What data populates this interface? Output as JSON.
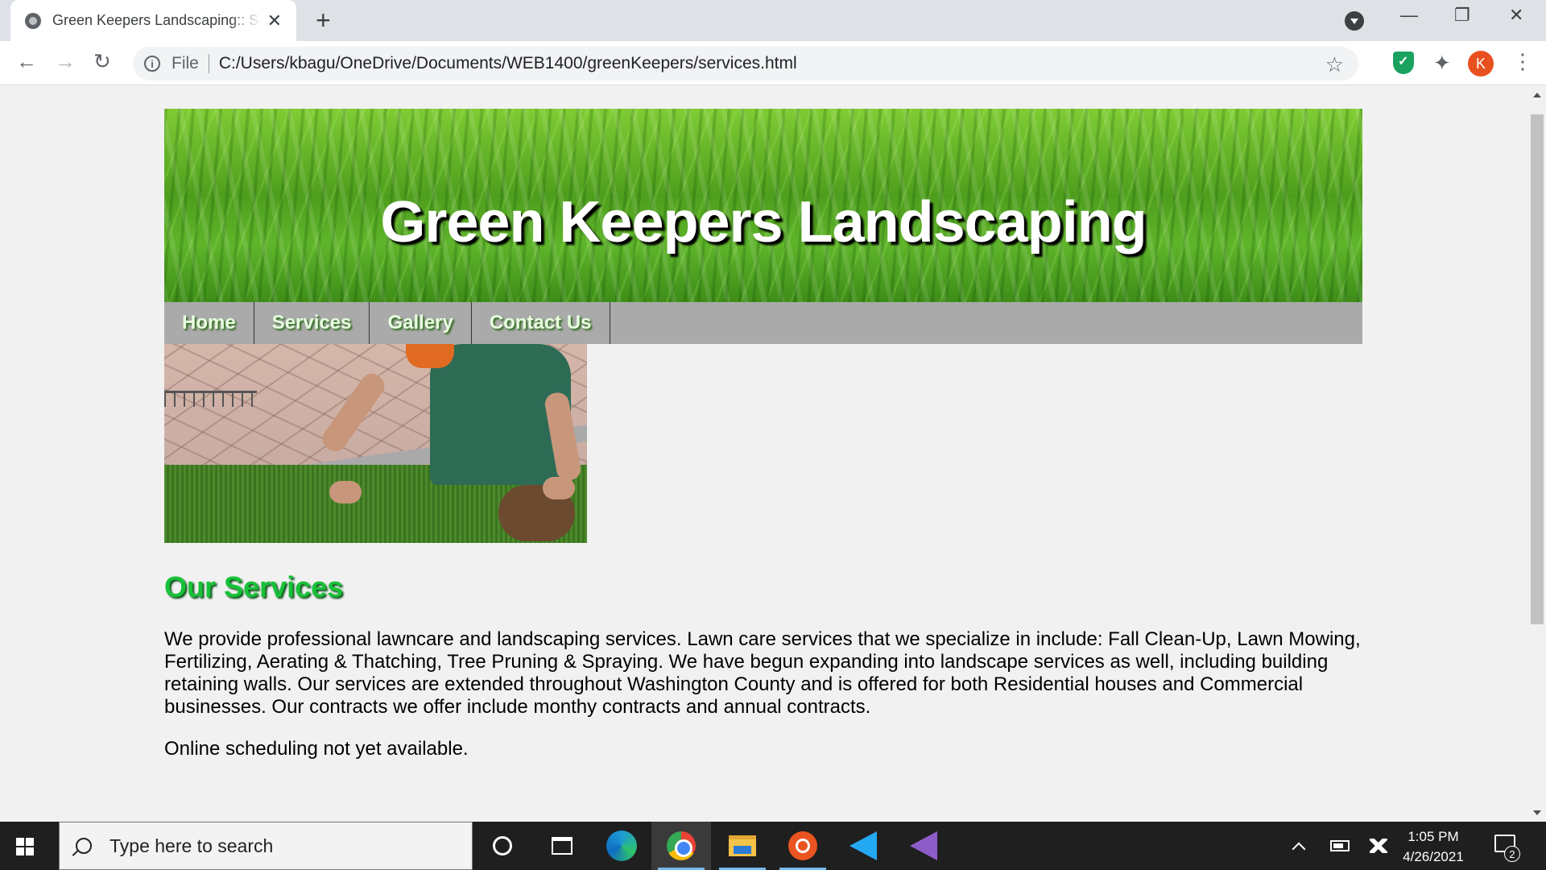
{
  "browser": {
    "tab_title": "Green Keepers Landscaping:: Services",
    "new_tab_icon": "plus-icon",
    "omnibox": {
      "scheme_label": "File",
      "url": "C:/Users/kbagu/OneDrive/Documents/WEB1400/greenKeepers/services.html"
    },
    "profile_initial": "K",
    "window_controls": {
      "minimize": "—",
      "restore": "❐",
      "close": "✕"
    }
  },
  "site": {
    "banner_title": "Green Keepers Landscaping",
    "nav": [
      "Home",
      "Services",
      "Gallery",
      "Contact Us"
    ],
    "heading": "Our Services",
    "paragraph": "We provide professional lawncare and landscaping services. Lawn care services that we specialize in include: Fall Clean-Up, Lawn Mowing, Fertilizing, Aerating & Thatching, Tree Pruning & Spraying. We have begun expanding into landscape services as well, including building retaining walls. Our services are extended throughout Washington County and is offered for both Residential houses and Commercial businesses. Our contracts we offer include monthy contracts and annual contracts.",
    "note": "Online scheduling not yet available.",
    "colors": {
      "heading": "#17c139",
      "nav_bg": "#aaaaaa",
      "banner_green": "#4e9e1d"
    }
  },
  "taskbar": {
    "search_placeholder": "Type here to search",
    "time": "1:05 PM",
    "date": "4/26/2021",
    "notification_count": "2"
  }
}
